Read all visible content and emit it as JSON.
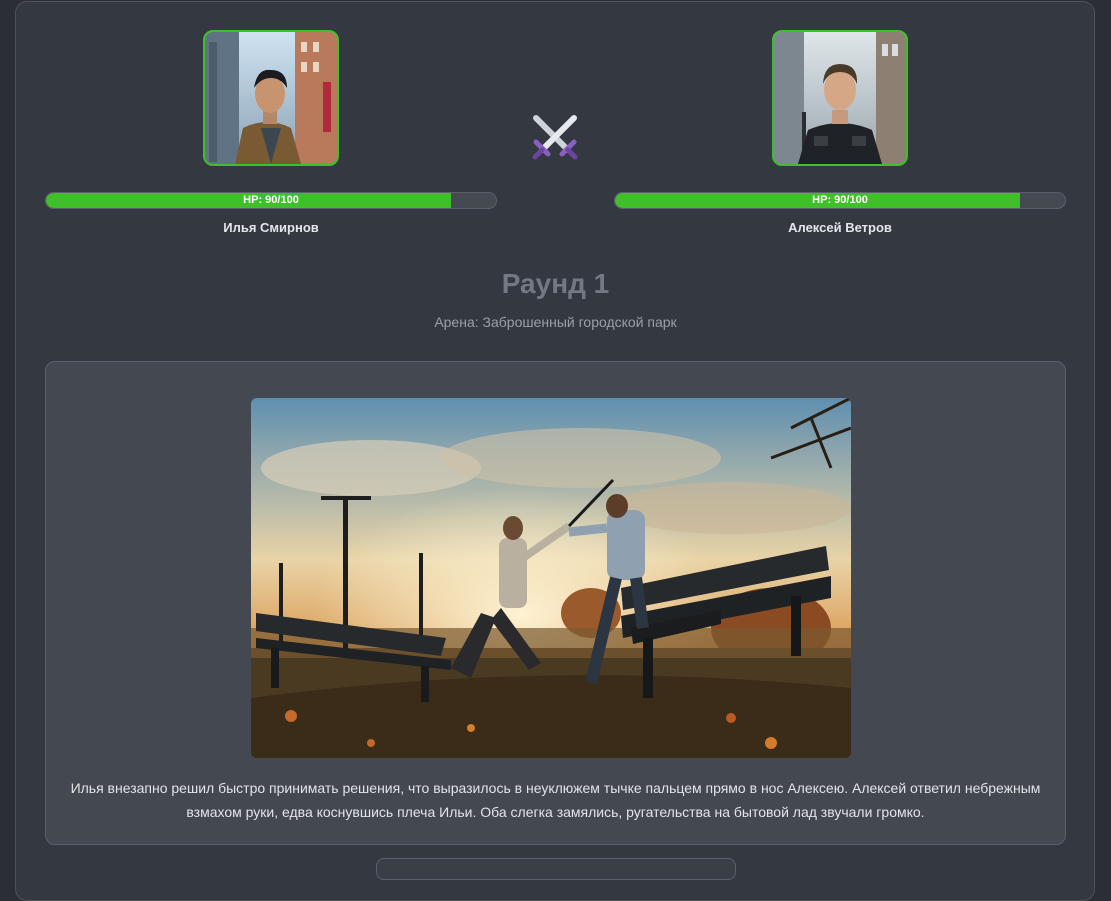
{
  "fighters": [
    {
      "name": "Илья Смирнов",
      "hp_text": "HP: 90/100",
      "hp_value": 90,
      "hp_max": 100
    },
    {
      "name": "Алексей Ветров",
      "hp_text": "HP: 90/100",
      "hp_value": 90,
      "hp_max": 100
    }
  ],
  "round": {
    "title": "Раунд 1",
    "arena": "Арена: Заброшенный городской парк"
  },
  "narration": "Илья внезапно решил быстро принимать решения, что выразилось в неуклюжем тычке пальцем прямо в нос Алексею. Алексей ответил небрежным взмахом руки, едва коснувшись плеча Ильи. Оба слегка замялись, ругательства на бытовой лад звучали громко.",
  "icons": {
    "vs": "crossed-swords-icon"
  },
  "colors": {
    "hp_bar": "#3fbf2a",
    "avatar_border": "#3fbf2a",
    "panel": "#343840",
    "card": "#434851"
  }
}
